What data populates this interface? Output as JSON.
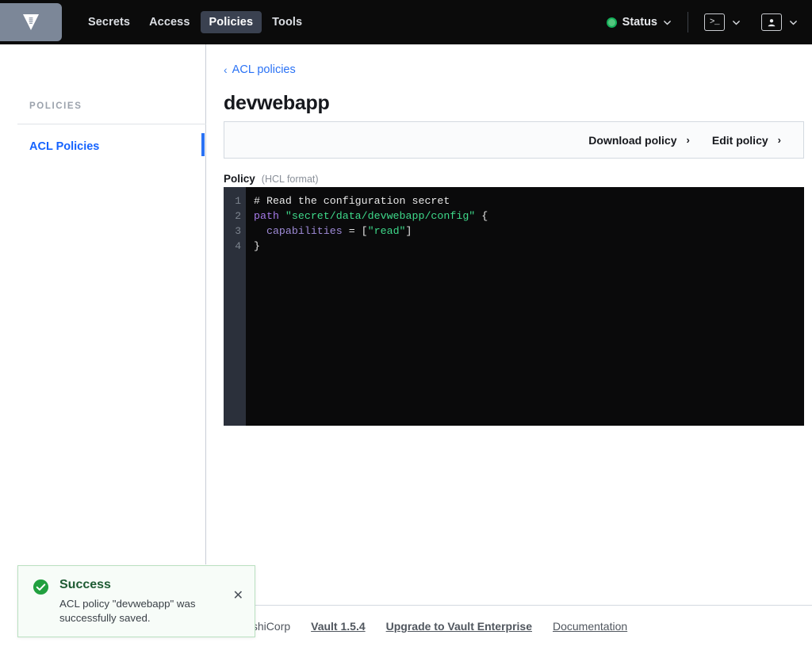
{
  "navbar": {
    "logo_icon": "vault-logo-icon",
    "links": [
      {
        "label": "Secrets",
        "active": false
      },
      {
        "label": "Access",
        "active": false
      },
      {
        "label": "Policies",
        "active": true
      },
      {
        "label": "Tools",
        "active": false
      }
    ],
    "status": {
      "label": "Status",
      "dot_color": "#14b05a",
      "chevron_icon": "chevron-down-icon"
    },
    "console_button": {
      "icon": "terminal-icon",
      "glyph": ">_",
      "chevron_icon": "chevron-down-icon"
    },
    "user_button": {
      "icon": "user-icon",
      "chevron_icon": "chevron-down-icon"
    }
  },
  "sidebar": {
    "section_label": "POLICIES",
    "items": [
      {
        "label": "ACL Policies",
        "active": true
      }
    ],
    "accent_color": "#2a72f5"
  },
  "main": {
    "breadcrumb": {
      "chevron_icon": "chevron-left-icon",
      "label": "ACL policies"
    },
    "page_title": "devwebapp",
    "actions": [
      {
        "label": "Download policy",
        "chevron_icon": "chevron-right-icon"
      },
      {
        "label": "Edit policy",
        "chevron_icon": "chevron-right-icon"
      }
    ],
    "policy": {
      "label": "Policy",
      "format_hint": "(HCL format)",
      "line_numbers": [
        "1",
        "2",
        "3",
        "4"
      ],
      "lines": [
        {
          "tokens": [
            {
              "t": "comment",
              "v": "# Read the configuration secret"
            }
          ]
        },
        {
          "tokens": [
            {
              "t": "key",
              "v": "path"
            },
            {
              "t": "punct",
              "v": " "
            },
            {
              "t": "str",
              "v": "\"secret/data/devwebapp/config\""
            },
            {
              "t": "punct",
              "v": " {"
            }
          ]
        },
        {
          "tokens": [
            {
              "t": "punct",
              "v": "  "
            },
            {
              "t": "attr",
              "v": "capabilities"
            },
            {
              "t": "punct",
              "v": " = ["
            },
            {
              "t": "str",
              "v": "\"read\""
            },
            {
              "t": "punct",
              "v": "]"
            }
          ]
        },
        {
          "tokens": [
            {
              "t": "punct",
              "v": "}"
            }
          ]
        }
      ]
    }
  },
  "toast": {
    "icon": "check-circle-icon",
    "title": "Success",
    "message": "ACL policy \"devwebapp\" was successfully saved.",
    "close_icon": "close-icon",
    "accent_color": "#21a03f"
  },
  "footer": {
    "copyright": "HashiCorp",
    "links": [
      {
        "label": "Vault 1.5.4",
        "strong": true
      },
      {
        "label": "Upgrade to Vault Enterprise",
        "strong": true
      },
      {
        "label": "Documentation",
        "strong": false
      }
    ]
  }
}
